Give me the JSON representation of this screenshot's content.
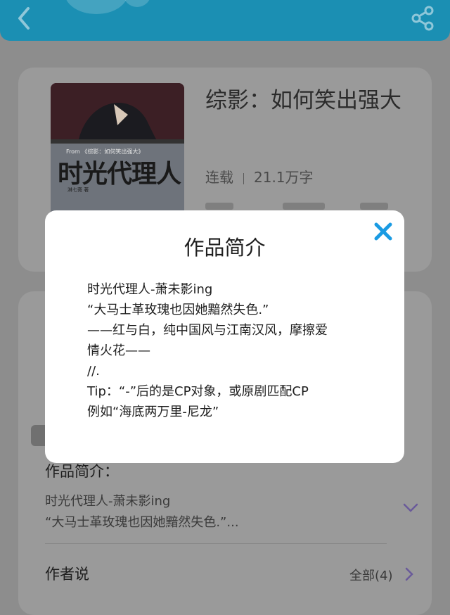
{
  "header": {
    "back_icon": "chevron-left-icon",
    "share_icon": "share-icon",
    "color": "#1b8fb3"
  },
  "book": {
    "cover_title": "时光代理人",
    "cover_subtitle": "From 《综影：如何笑出强大》",
    "cover_author": "淋七斋 著",
    "title": "综影：如何笑出强大",
    "status": "连载",
    "word_count": "21.1万字"
  },
  "detail": {
    "intro_heading": "作品简介：",
    "intro_preview": [
      "时光代理人-萧未影ing",
      "“大马士革玫瑰也因她黯然失色.”..."
    ],
    "expand_icon": "chevron-down-icon",
    "author_says": "作者说",
    "all_label": "全部(4)",
    "all_icon": "chevron-right-icon"
  },
  "modal": {
    "title": "作品简介",
    "close_icon": "close-icon",
    "lines": [
      "时光代理人-萧未影ing",
      "“大马士革玫瑰也因她黯然失色.”",
      "——红与白，纯中国风与江南汉风，摩擦爱",
      "情火花——",
      "//.",
      "Tip：“-”后的是CP对象，或原剧匹配CP",
      "例如“海底两万里-尼龙”"
    ],
    "accent": "#1a9be3"
  }
}
